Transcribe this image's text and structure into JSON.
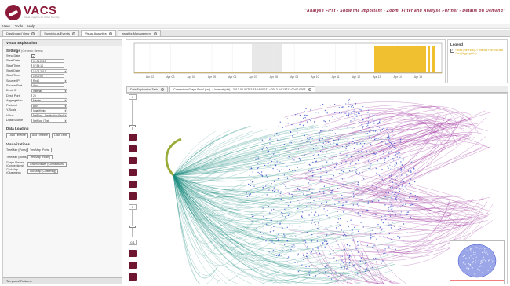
{
  "header": {
    "logo": "VACS",
    "logo_sub": "Visual Analytics for Cyber Security",
    "tagline": "\"Analyse First - Show the Important - Zoom, Filter and Analyse Further - Details on Demand\""
  },
  "menu": [
    "View",
    "Tools",
    "Help"
  ],
  "tabs": [
    {
      "label": "Dashboard View",
      "active": false
    },
    {
      "label": "Suspicious Events",
      "active": false
    },
    {
      "label": "Visual Analytics",
      "active": true
    },
    {
      "label": "Insights Management",
      "active": false
    }
  ],
  "left_panel": {
    "title": "Visual Exploration",
    "settings_label": "Settings",
    "settings_sub": "(Generic Items)",
    "fields": [
      {
        "label": "Sync Date",
        "type": "check",
        "value": "✓"
      },
      {
        "label": "Start Date",
        "type": "text",
        "value": "01.04.2013"
      },
      {
        "label": "Start Time",
        "type": "text",
        "value": "07:53:14"
      },
      {
        "label": "Start Date",
        "type": "select",
        "value": "13.04.2013"
      },
      {
        "label": "Start Time",
        "type": "text",
        "value": "13:00:00"
      },
      {
        "label": "Source IP",
        "type": "select",
        "value": "Rnd4"
      },
      {
        "label": "Source Port",
        "type": "text",
        "value": "Any"
      },
      {
        "label": "Dest. IP",
        "type": "select",
        "value": "Internal"
      },
      {
        "label": "Dest. Port",
        "type": "text",
        "value": "25"
      },
      {
        "label": "Aggregation",
        "type": "select",
        "value": "Minute"
      },
      {
        "label": "Protocol",
        "type": "select",
        "value": "Any"
      },
      {
        "label": "Y-Scale",
        "type": "select",
        "value": "logarithmic"
      },
      {
        "label": "Value",
        "type": "select",
        "value": "NetFlow - Destination Packets"
      },
      {
        "label": "Data Source",
        "type": "select",
        "value": "NetFlow (Test)"
      }
    ],
    "data_loading_label": "Data Loading",
    "load_buttons": [
      "Load Timeline",
      "Add Timeline",
      "Load Table"
    ],
    "visualizations_label": "Visualizations",
    "viz_rows": [
      {
        "label": "TreeMap (Ports)",
        "button": "TreeMap (Ports)"
      },
      {
        "label": "TreeMap (Hosts)",
        "button": "TreeMap (Hosts)"
      },
      {
        "label": "Graph Viewer (Connections)",
        "button": "Graph Viewer (Connections)"
      },
      {
        "label": "ClickMap (Clustering)",
        "button": "ClickMap (Clustering)"
      }
    ],
    "footer": "Temporal Patterns"
  },
  "timeline": {
    "x_ticks": [
      "Apr 02",
      "Apr 03",
      "Apr 04",
      "Apr 05",
      "Apr 06",
      "Apr 07",
      "Apr 08",
      "Apr 09",
      "Apr 10",
      "Apr 11",
      "Apr 12",
      "Apr 13",
      "Apr 14",
      "Apr 15"
    ],
    "highlight_color": "#f0c030"
  },
  "legend": {
    "title": "Legend",
    "item": "Flows (NetFlow) -> Internal Port 25 Dest Port (Aggregated)"
  },
  "graph_tabs": [
    {
      "label": "Data Exploration Table",
      "active": false
    },
    {
      "label": "Connection Graph Rnd4 (src) -> Internal (dst) - 2013-04-01T07:53:14.000Z -> 2013-04-13T13:00:00.000Z",
      "active": true
    }
  ],
  "graph_toolbar": {
    "zoom_top": "1",
    "zoom_mid": "0",
    "zoom_bottom": "0.1"
  },
  "colors": {
    "brand": "#8b1a3a",
    "edge_teal": "#1b8c7e",
    "edge_purple": "#9b2d9b",
    "node_blue": "#3a4fd0"
  }
}
